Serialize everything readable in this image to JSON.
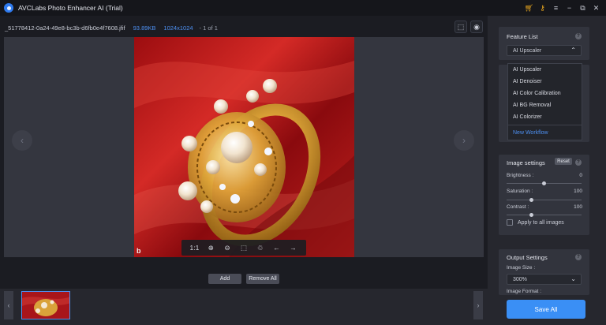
{
  "window": {
    "title": "AVCLabs Photo Enhancer AI (Trial)",
    "icons": [
      "cart-icon",
      "key-icon",
      "menu-icon",
      "minimize-icon",
      "restore-icon",
      "close-icon"
    ]
  },
  "file_info": {
    "name": "_51778412-0a24-49e8-bc3b-d6fb0e4f7608.jfif",
    "size": "93.89KB",
    "dimensions": "1024x1024",
    "page": "- 1 of 1"
  },
  "zoom_toolbar": {
    "ratio_label": "1:1",
    "icons": [
      "zoom-in-icon",
      "zoom-out-icon",
      "crop-icon",
      "trash-icon",
      "arrow-left-icon",
      "arrow-right-icon"
    ]
  },
  "photo": {
    "watermark": "b"
  },
  "bottom": {
    "add_label": "Add",
    "remove_all_label": "Remove All"
  },
  "feature_list": {
    "title": "Feature List",
    "selected": "AI Upscaler",
    "options": [
      "AI Upscaler",
      "AI Denoiser",
      "AI Color Calibration",
      "AI BG Removal",
      "AI Colorizer"
    ],
    "new_workflow": "New Workflow"
  },
  "image_settings": {
    "title": "Image settings",
    "reset_label": "Reset",
    "sliders": [
      {
        "label": "Brightness :",
        "value": "0",
        "level": 0.5
      },
      {
        "label": "Saturation :",
        "value": "100",
        "level": 0.33
      },
      {
        "label": "Contrast :",
        "value": "100",
        "level": 0.33
      }
    ],
    "apply_all_label": "Apply to all images"
  },
  "output_settings": {
    "title": "Output Settings",
    "image_size_label": "Image Size :",
    "image_size_value": "300%",
    "image_format_label": "Image Format :"
  },
  "save_all_label": "Save All",
  "colors": {
    "accent": "#3a8ff5",
    "link": "#4d8ff0",
    "title_bar": "#15161b",
    "panel": "#26272e"
  }
}
